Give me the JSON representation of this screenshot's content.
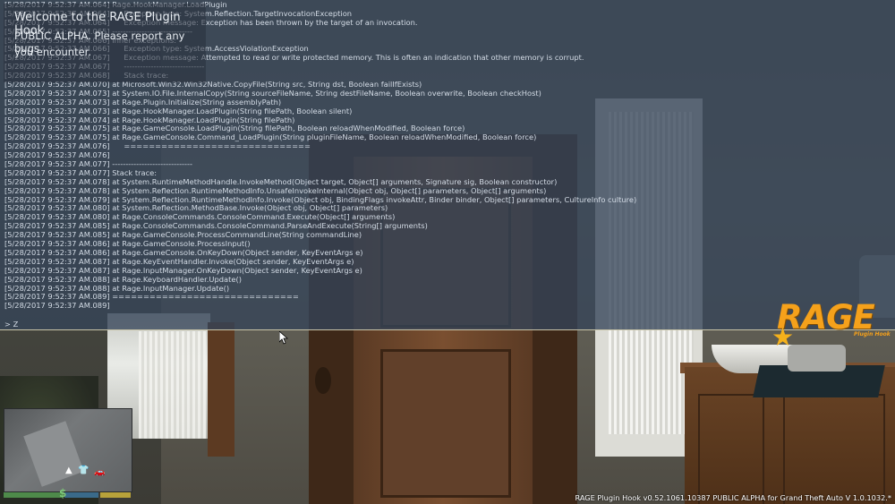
{
  "notification": {
    "title": "Welcome to the RAGE Plugin Hook",
    "line1": "PUBLIC ALPHA. Please report any bugs",
    "line2": "you encounter."
  },
  "console": {
    "lines": [
      "[5/28/2017 9:52:37 AM.064] Rage.HookManager.LoadPlugin",
      "[5/28/2017 9:52:37 AM.064]      Exception type: System.Reflection.TargetInvocationException",
      "[5/28/2017 9:52:37 AM.064]      Exception message: Exception has been thrown by the target of an invocation.",
      "[5/28/2017 9:52:37 AM.065] ------------------------------",
      "[5/28/2017 9:52:37 AM.066] Inner exceptions:",
      "[5/28/2017 9:52:37 AM.066]      Exception type: System.AccessViolationException",
      "[5/28/2017 9:52:37 AM.067]      Exception message: Attempted to read or write protected memory. This is often an indication that other memory is corrupt.",
      "[5/28/2017 9:52:37 AM.067]      ------------------------------",
      "[5/28/2017 9:52:37 AM.068]      Stack trace:",
      "[5/28/2017 9:52:37 AM.070] at Microsoft.Win32.Win32Native.CopyFile(String src, String dst, Boolean failIfExists)",
      "[5/28/2017 9:52:37 AM.073] at System.IO.File.InternalCopy(String sourceFileName, String destFileName, Boolean overwrite, Boolean checkHost)",
      "[5/28/2017 9:52:37 AM.073] at Rage.Plugin.Initialize(String assemblyPath)",
      "[5/28/2017 9:52:37 AM.073] at Rage.HookManager.LoadPlugin(String filePath, Boolean silent)",
      "[5/28/2017 9:52:37 AM.074] at Rage.HookManager.LoadPlugin(String filePath)",
      "[5/28/2017 9:52:37 AM.075] at Rage.GameConsole.LoadPlugin(String filePath, Boolean reloadWhenModified, Boolean force)",
      "[5/28/2017 9:52:37 AM.075] at Rage.GameConsole.Command_LoadPlugin(String pluginFileName, Boolean reloadWhenModified, Boolean force)",
      "[5/28/2017 9:52:37 AM.076]      ==============================",
      "[5/28/2017 9:52:37 AM.076]",
      "[5/28/2017 9:52:37 AM.077] ------------------------------",
      "[5/28/2017 9:52:37 AM.077] Stack trace:",
      "[5/28/2017 9:52:37 AM.078] at System.RuntimeMethodHandle.InvokeMethod(Object target, Object[] arguments, Signature sig, Boolean constructor)",
      "[5/28/2017 9:52:37 AM.078] at System.Reflection.RuntimeMethodInfo.UnsafeInvokeInternal(Object obj, Object[] parameters, Object[] arguments)",
      "[5/28/2017 9:52:37 AM.079] at System.Reflection.RuntimeMethodInfo.Invoke(Object obj, BindingFlags invokeAttr, Binder binder, Object[] parameters, CultureInfo culture)",
      "[5/28/2017 9:52:37 AM.080] at System.Reflection.MethodBase.Invoke(Object obj, Object[] parameters)",
      "[5/28/2017 9:52:37 AM.080] at Rage.ConsoleCommands.ConsoleCommand.Execute(Object[] arguments)",
      "[5/28/2017 9:52:37 AM.085] at Rage.ConsoleCommands.ConsoleCommand.ParseAndExecute(String[] arguments)",
      "[5/28/2017 9:52:37 AM.085] at Rage.GameConsole.ProcessCommandLine(String commandLine)",
      "[5/28/2017 9:52:37 AM.086] at Rage.GameConsole.ProcessInput()",
      "[5/28/2017 9:52:37 AM.086] at Rage.GameConsole.OnKeyDown(Object sender, KeyEventArgs e)",
      "[5/28/2017 9:52:37 AM.087] at Rage.KeyEventHandler.Invoke(Object sender, KeyEventArgs e)",
      "[5/28/2017 9:52:37 AM.087] at Rage.InputManager.OnKeyDown(Object sender, KeyEventArgs e)",
      "[5/28/2017 9:52:37 AM.088] at Rage.KeyboardHandler.Update()",
      "[5/28/2017 9:52:37 AM.088] at Rage.InputManager.Update()",
      "[5/28/2017 9:52:37 AM.089] ==============================",
      "[5/28/2017 9:52:37 AM.089]"
    ],
    "input": "> Z"
  },
  "logo": {
    "text": "RAGE",
    "subtitle": "Plugin Hook",
    "color": "#f5a11b"
  },
  "hud": {
    "cash_symbol": "$",
    "health_color": "#4e8a4a",
    "armor_color": "#3a6a8a",
    "special_color": "#b8a23a",
    "map_icons": [
      "arrow-up-icon",
      "shirt-icon",
      "car-icon"
    ]
  },
  "footer": {
    "version": "RAGE Plugin Hook v0.52.1061.10387 PUBLIC ALPHA for Grand Theft Auto V 1.0.1032.*"
  }
}
